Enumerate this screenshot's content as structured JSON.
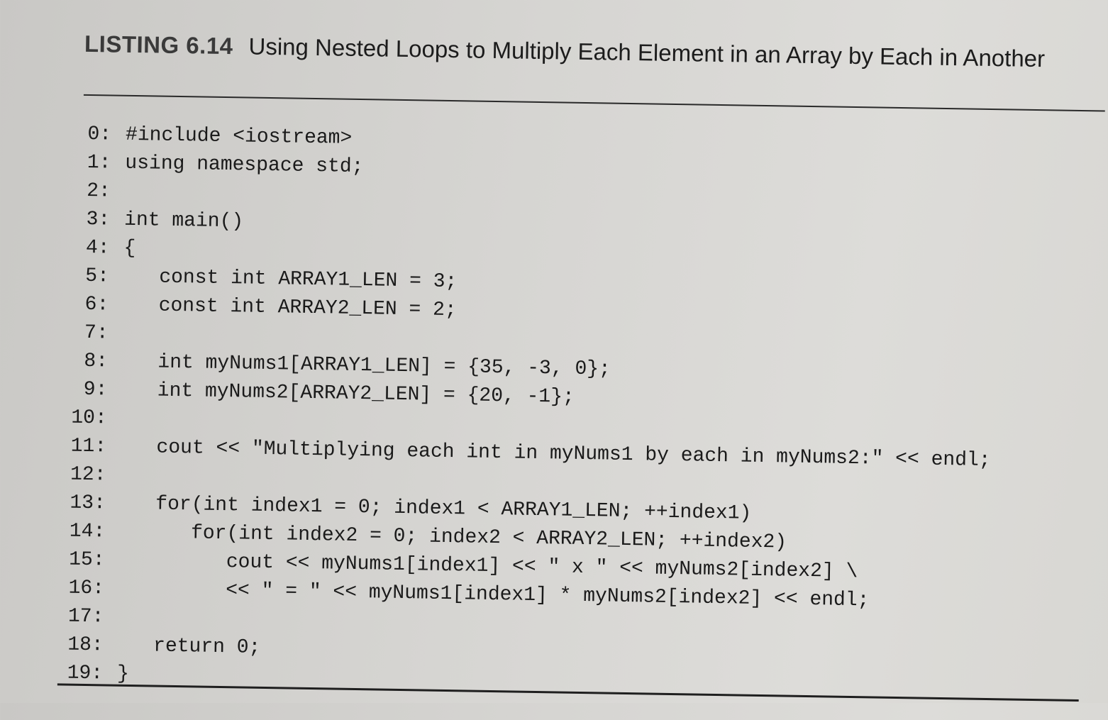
{
  "listing": {
    "label": "LISTING 6.14",
    "title": "Using Nested Loops to Multiply Each Element in an Array by Each in Another"
  },
  "code_lines": [
    {
      "number": "0:",
      "text": "#include <iostream>"
    },
    {
      "number": "1:",
      "text": "using namespace std;"
    },
    {
      "number": "2:",
      "text": ""
    },
    {
      "number": "3:",
      "text": "int main()"
    },
    {
      "number": "4:",
      "text": "{"
    },
    {
      "number": "5:",
      "text": "   const int ARRAY1_LEN = 3;"
    },
    {
      "number": "6:",
      "text": "   const int ARRAY2_LEN = 2;"
    },
    {
      "number": "7:",
      "text": ""
    },
    {
      "number": "8:",
      "text": "   int myNums1[ARRAY1_LEN] = {35, -3, 0};"
    },
    {
      "number": "9:",
      "text": "   int myNums2[ARRAY2_LEN] = {20, -1};"
    },
    {
      "number": "10:",
      "text": ""
    },
    {
      "number": "11:",
      "text": "   cout << \"Multiplying each int in myNums1 by each in myNums2:\" << endl;"
    },
    {
      "number": "12:",
      "text": ""
    },
    {
      "number": "13:",
      "text": "   for(int index1 = 0; index1 < ARRAY1_LEN; ++index1)"
    },
    {
      "number": "14:",
      "text": "      for(int index2 = 0; index2 < ARRAY2_LEN; ++index2)"
    },
    {
      "number": "15:",
      "text": "         cout << myNums1[index1] << \" x \" << myNums2[index2] \\"
    },
    {
      "number": "16:",
      "text": "         << \" = \" << myNums1[index1] * myNums2[index2] << endl;"
    },
    {
      "number": "17:",
      "text": ""
    },
    {
      "number": "18:",
      "text": "   return 0;"
    },
    {
      "number": "19:",
      "text": "}"
    }
  ]
}
